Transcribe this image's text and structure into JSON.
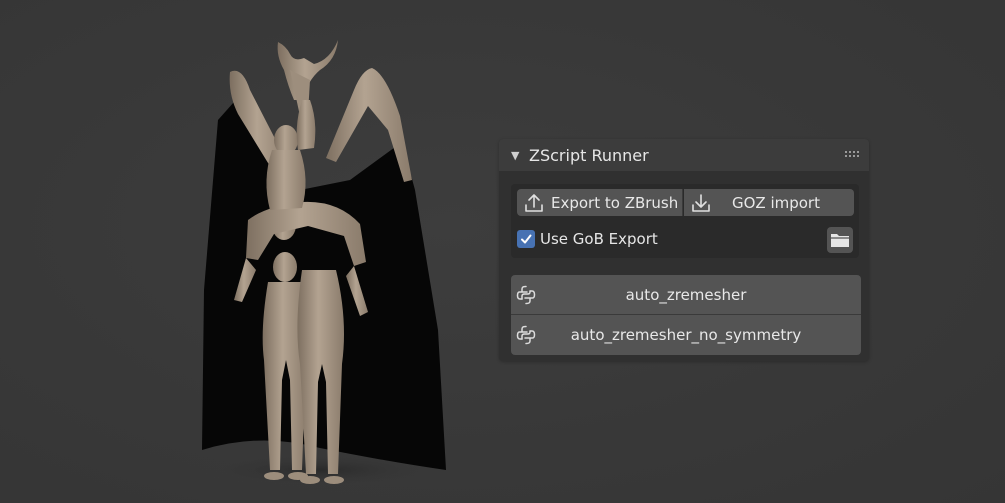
{
  "viewport": {
    "background": "#393939",
    "model": "demon-figure-sculpt"
  },
  "panel": {
    "title": "ZScript Runner",
    "collapse_icon": "triangle-down-icon",
    "drag_icon": "drag-handle-icon",
    "export_button": {
      "label": "Export to ZBrush",
      "icon": "upload-icon"
    },
    "goz_button": {
      "label": "GOZ import",
      "icon": "download-icon"
    },
    "gob_export": {
      "label": "Use GoB Export",
      "checked": true
    },
    "folder_button": {
      "icon": "folder-icon"
    },
    "scripts": [
      {
        "label": "auto_zremesher",
        "icon": "python-icon"
      },
      {
        "label": "auto_zremesher_no_symmetry",
        "icon": "python-icon"
      }
    ]
  },
  "colors": {
    "accent_checkbox": "#4772b3",
    "button": "#545454",
    "panel": "#303030",
    "panel_header": "#3c3c3c",
    "model_clay": "#a89886",
    "cape": "#050505"
  }
}
